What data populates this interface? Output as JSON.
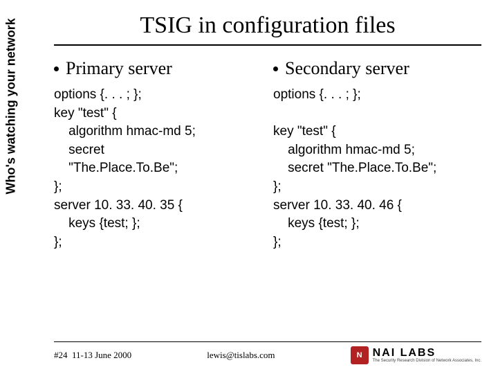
{
  "sidebar": {
    "tagline": "Who's watching your network"
  },
  "title": "TSIG in configuration files",
  "columns": {
    "left": {
      "heading": "Primary server",
      "code": "options {. . . ; };\nkey \"test\" {\n    algorithm hmac-md 5;\n    secret\n    \"The.Place.To.Be\";\n};\nserver 10. 33. 40. 35 {\n    keys {test; };\n};"
    },
    "right": {
      "heading": "Secondary server",
      "code": "options {. . . ; };\n\nkey \"test\" {\n    algorithm hmac-md 5;\n    secret \"The.Place.To.Be\";\n};\nserver 10. 33. 40. 46 {\n    keys {test; };\n};"
    }
  },
  "footer": {
    "slide": "#24",
    "date": "11-13 June 2000",
    "email": "lewis@tislabs.com",
    "logo_mark": "N",
    "logo_main": "NAI LABS",
    "logo_sub": "The Security Research Division of Network Associates, Inc."
  }
}
